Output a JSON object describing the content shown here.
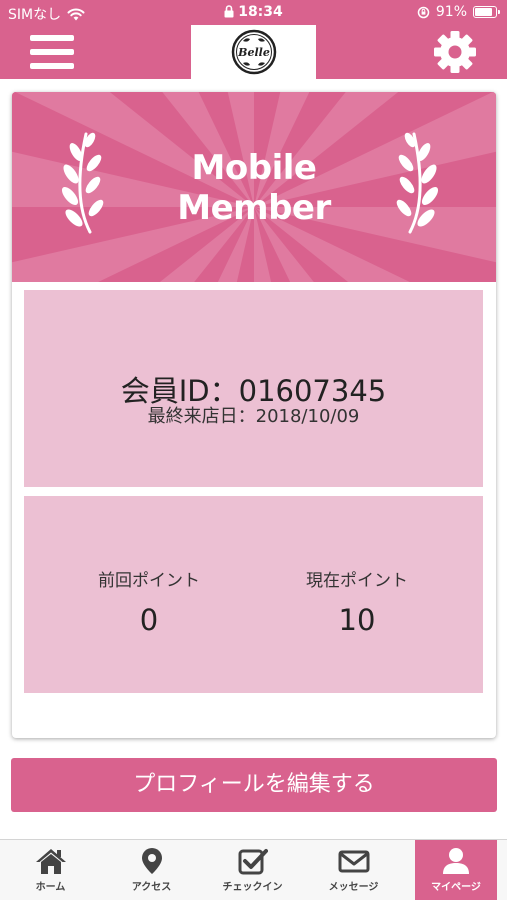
{
  "status_bar": {
    "carrier": "SIMなし",
    "time": "18:34",
    "battery": "91%",
    "battery_level": 0.91
  },
  "header": {
    "logo_text": "Belle",
    "menu_icon": "hamburger-menu-icon",
    "settings_icon": "gear-icon"
  },
  "card": {
    "banner": {
      "title_line1": "Mobile",
      "title_line2": "Member"
    },
    "member": {
      "id_text": "会員ID：01607345",
      "last_visit_text": "最終来店日：2018/10/09"
    },
    "points": {
      "previous_label": "前回ポイント",
      "previous_value": "0",
      "current_label": "現在ポイント",
      "current_value": "10"
    }
  },
  "edit_profile_label": "プロフィールを編集する",
  "tabs": [
    {
      "label": "ホーム",
      "icon": "home-icon"
    },
    {
      "label": "アクセス",
      "icon": "map-pin-icon"
    },
    {
      "label": "チェックイン",
      "icon": "checkbox-icon"
    },
    {
      "label": "メッセージ",
      "icon": "envelope-icon"
    },
    {
      "label": "マイページ",
      "icon": "user-icon",
      "active": true
    }
  ],
  "colors": {
    "brand_pink": "#d9628e",
    "panel_pink": "#ecc0d3"
  }
}
